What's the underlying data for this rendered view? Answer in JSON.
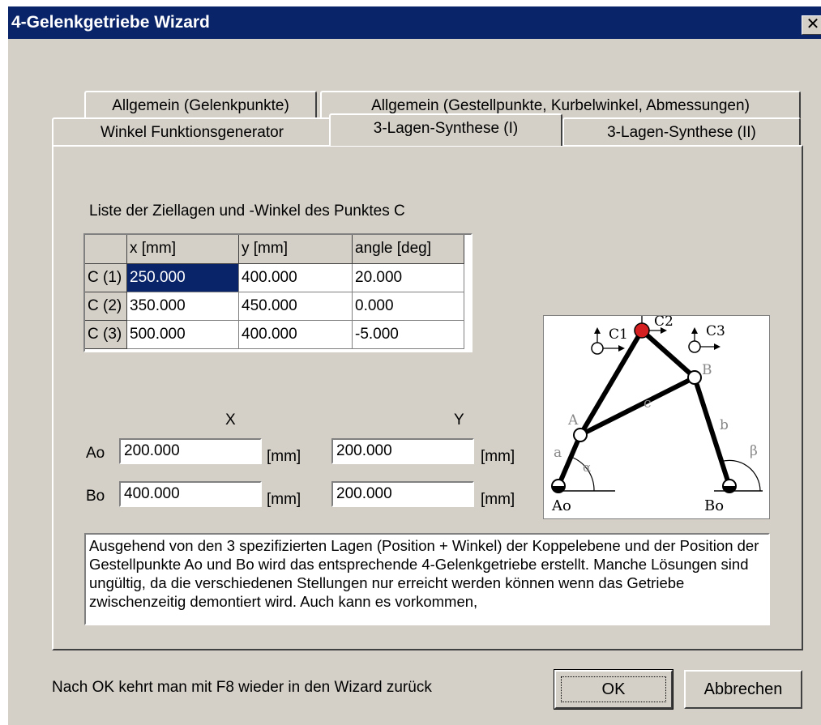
{
  "window": {
    "title": "4-Gelenkgetriebe Wizard",
    "close_glyph": "✕"
  },
  "tabs": {
    "row1": [
      "Allgemein (Gelenkpunkte)",
      "Allgemein (Gestellpunkte, Kurbelwinkel, Abmessungen)"
    ],
    "row2": [
      "Winkel Funktionsgenerator",
      "3-Lagen-Synthese (I)",
      "3-Lagen-Synthese (II)"
    ],
    "active": "3-Lagen-Synthese (I)"
  },
  "list_title": "Liste der Ziellagen und -Winkel des Punktes C",
  "table": {
    "columns": [
      "x [mm]",
      "y [mm]",
      "angle [deg]"
    ],
    "rows": [
      {
        "label": "C (1)",
        "x": "250.000",
        "y": "400.000",
        "angle": "20.000"
      },
      {
        "label": "C (2)",
        "x": "350.000",
        "y": "450.000",
        "angle": "0.000"
      },
      {
        "label": "C (3)",
        "x": "500.000",
        "y": "400.000",
        "angle": "-5.000"
      }
    ]
  },
  "coords": {
    "x_header": "X",
    "y_header": "Y",
    "unit": "[mm]",
    "ao": {
      "label": "Ao",
      "x": "200.000",
      "y": "200.000"
    },
    "bo": {
      "label": "Bo",
      "x": "400.000",
      "y": "200.000"
    }
  },
  "diagram": {
    "labels": {
      "c1": "C1",
      "c2": "C2",
      "c3": "C3",
      "a_point": "A",
      "b_point": "B",
      "a_link": "a",
      "b_link": "b",
      "c_link": "c",
      "alpha": "α",
      "beta": "β",
      "ao": "Ao",
      "bo": "Bo"
    },
    "colors": {
      "c2_point": "#d42020"
    }
  },
  "description": "Ausgehend von den 3 spezifizierten Lagen (Position + Winkel) der Koppelebene und der Position der Gestellpunkte Ao und Bo wird das entsprechende 4-Gelenkgetriebe erstellt. Manche Lösungen sind ungültig, da die verschiedenen Stellungen nur erreicht werden können wenn das Getriebe zwischenzeitig demontiert wird. Auch kann es vorkommen,",
  "footer": {
    "hint": "Nach OK kehrt man mit F8 wieder in den Wizard zurück",
    "ok": "OK",
    "cancel": "Abbrechen"
  }
}
